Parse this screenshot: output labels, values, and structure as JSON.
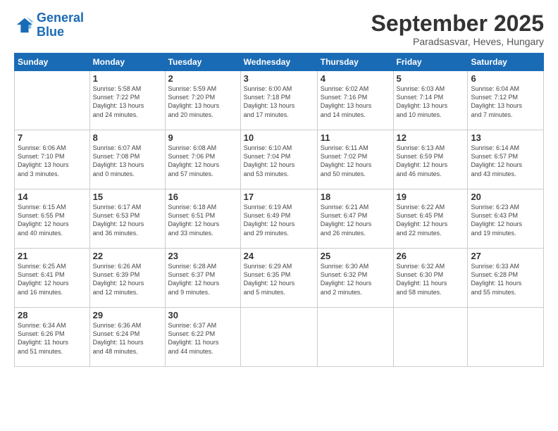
{
  "logo": {
    "line1": "General",
    "line2": "Blue"
  },
  "title": "September 2025",
  "subtitle": "Paradsasvar, Heves, Hungary",
  "header_days": [
    "Sunday",
    "Monday",
    "Tuesday",
    "Wednesday",
    "Thursday",
    "Friday",
    "Saturday"
  ],
  "weeks": [
    [
      {
        "day": "",
        "info": ""
      },
      {
        "day": "1",
        "info": "Sunrise: 5:58 AM\nSunset: 7:22 PM\nDaylight: 13 hours\nand 24 minutes."
      },
      {
        "day": "2",
        "info": "Sunrise: 5:59 AM\nSunset: 7:20 PM\nDaylight: 13 hours\nand 20 minutes."
      },
      {
        "day": "3",
        "info": "Sunrise: 6:00 AM\nSunset: 7:18 PM\nDaylight: 13 hours\nand 17 minutes."
      },
      {
        "day": "4",
        "info": "Sunrise: 6:02 AM\nSunset: 7:16 PM\nDaylight: 13 hours\nand 14 minutes."
      },
      {
        "day": "5",
        "info": "Sunrise: 6:03 AM\nSunset: 7:14 PM\nDaylight: 13 hours\nand 10 minutes."
      },
      {
        "day": "6",
        "info": "Sunrise: 6:04 AM\nSunset: 7:12 PM\nDaylight: 13 hours\nand 7 minutes."
      }
    ],
    [
      {
        "day": "7",
        "info": "Sunrise: 6:06 AM\nSunset: 7:10 PM\nDaylight: 13 hours\nand 3 minutes."
      },
      {
        "day": "8",
        "info": "Sunrise: 6:07 AM\nSunset: 7:08 PM\nDaylight: 13 hours\nand 0 minutes."
      },
      {
        "day": "9",
        "info": "Sunrise: 6:08 AM\nSunset: 7:06 PM\nDaylight: 12 hours\nand 57 minutes."
      },
      {
        "day": "10",
        "info": "Sunrise: 6:10 AM\nSunset: 7:04 PM\nDaylight: 12 hours\nand 53 minutes."
      },
      {
        "day": "11",
        "info": "Sunrise: 6:11 AM\nSunset: 7:02 PM\nDaylight: 12 hours\nand 50 minutes."
      },
      {
        "day": "12",
        "info": "Sunrise: 6:13 AM\nSunset: 6:59 PM\nDaylight: 12 hours\nand 46 minutes."
      },
      {
        "day": "13",
        "info": "Sunrise: 6:14 AM\nSunset: 6:57 PM\nDaylight: 12 hours\nand 43 minutes."
      }
    ],
    [
      {
        "day": "14",
        "info": "Sunrise: 6:15 AM\nSunset: 6:55 PM\nDaylight: 12 hours\nand 40 minutes."
      },
      {
        "day": "15",
        "info": "Sunrise: 6:17 AM\nSunset: 6:53 PM\nDaylight: 12 hours\nand 36 minutes."
      },
      {
        "day": "16",
        "info": "Sunrise: 6:18 AM\nSunset: 6:51 PM\nDaylight: 12 hours\nand 33 minutes."
      },
      {
        "day": "17",
        "info": "Sunrise: 6:19 AM\nSunset: 6:49 PM\nDaylight: 12 hours\nand 29 minutes."
      },
      {
        "day": "18",
        "info": "Sunrise: 6:21 AM\nSunset: 6:47 PM\nDaylight: 12 hours\nand 26 minutes."
      },
      {
        "day": "19",
        "info": "Sunrise: 6:22 AM\nSunset: 6:45 PM\nDaylight: 12 hours\nand 22 minutes."
      },
      {
        "day": "20",
        "info": "Sunrise: 6:23 AM\nSunset: 6:43 PM\nDaylight: 12 hours\nand 19 minutes."
      }
    ],
    [
      {
        "day": "21",
        "info": "Sunrise: 6:25 AM\nSunset: 6:41 PM\nDaylight: 12 hours\nand 16 minutes."
      },
      {
        "day": "22",
        "info": "Sunrise: 6:26 AM\nSunset: 6:39 PM\nDaylight: 12 hours\nand 12 minutes."
      },
      {
        "day": "23",
        "info": "Sunrise: 6:28 AM\nSunset: 6:37 PM\nDaylight: 12 hours\nand 9 minutes."
      },
      {
        "day": "24",
        "info": "Sunrise: 6:29 AM\nSunset: 6:35 PM\nDaylight: 12 hours\nand 5 minutes."
      },
      {
        "day": "25",
        "info": "Sunrise: 6:30 AM\nSunset: 6:32 PM\nDaylight: 12 hours\nand 2 minutes."
      },
      {
        "day": "26",
        "info": "Sunrise: 6:32 AM\nSunset: 6:30 PM\nDaylight: 11 hours\nand 58 minutes."
      },
      {
        "day": "27",
        "info": "Sunrise: 6:33 AM\nSunset: 6:28 PM\nDaylight: 11 hours\nand 55 minutes."
      }
    ],
    [
      {
        "day": "28",
        "info": "Sunrise: 6:34 AM\nSunset: 6:26 PM\nDaylight: 11 hours\nand 51 minutes."
      },
      {
        "day": "29",
        "info": "Sunrise: 6:36 AM\nSunset: 6:24 PM\nDaylight: 11 hours\nand 48 minutes."
      },
      {
        "day": "30",
        "info": "Sunrise: 6:37 AM\nSunset: 6:22 PM\nDaylight: 11 hours\nand 44 minutes."
      },
      {
        "day": "",
        "info": ""
      },
      {
        "day": "",
        "info": ""
      },
      {
        "day": "",
        "info": ""
      },
      {
        "day": "",
        "info": ""
      }
    ]
  ]
}
